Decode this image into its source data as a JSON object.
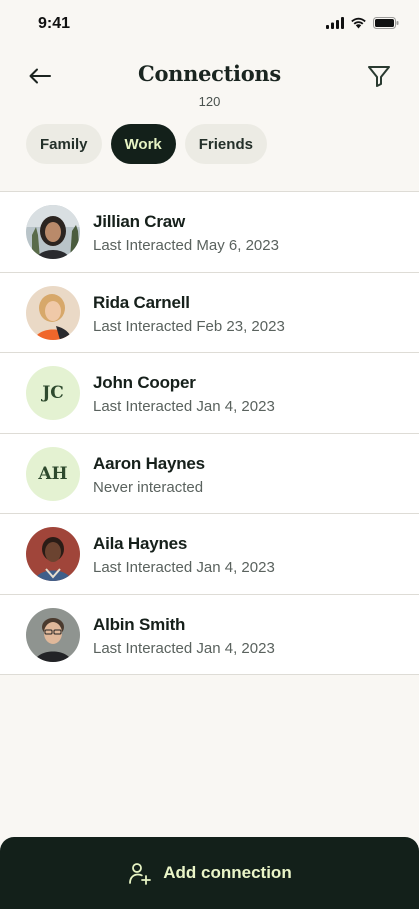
{
  "status": {
    "time": "9:41"
  },
  "header": {
    "title": "Connections",
    "count": "120"
  },
  "tabs": [
    {
      "label": "Family",
      "active": false
    },
    {
      "label": "Work",
      "active": true
    },
    {
      "label": "Friends",
      "active": false
    }
  ],
  "connections": [
    {
      "name": "Jillian Craw",
      "sub": "Last Interacted May 6, 2023",
      "avatar": "photo"
    },
    {
      "name": "Rida Carnell",
      "sub": "Last Interacted Feb 23, 2023",
      "avatar": "photo"
    },
    {
      "name": "John Cooper",
      "sub": "Last Interacted Jan 4, 2023",
      "avatar": "initials",
      "initials": "JC"
    },
    {
      "name": "Aaron Haynes",
      "sub": "Never interacted",
      "avatar": "initials",
      "initials": "AH"
    },
    {
      "name": "Aila Haynes",
      "sub": "Last Interacted Jan 4, 2023",
      "avatar": "photo"
    },
    {
      "name": "Albin Smith",
      "sub": "Last Interacted Jan 4, 2023",
      "avatar": "photo"
    }
  ],
  "footer": {
    "add_label": "Add connection"
  },
  "colors": {
    "background": "#f9f7f3",
    "accent_dark": "#13201a",
    "accent_light": "#e6f3c4",
    "initials_bg": "#e4f2d2"
  }
}
